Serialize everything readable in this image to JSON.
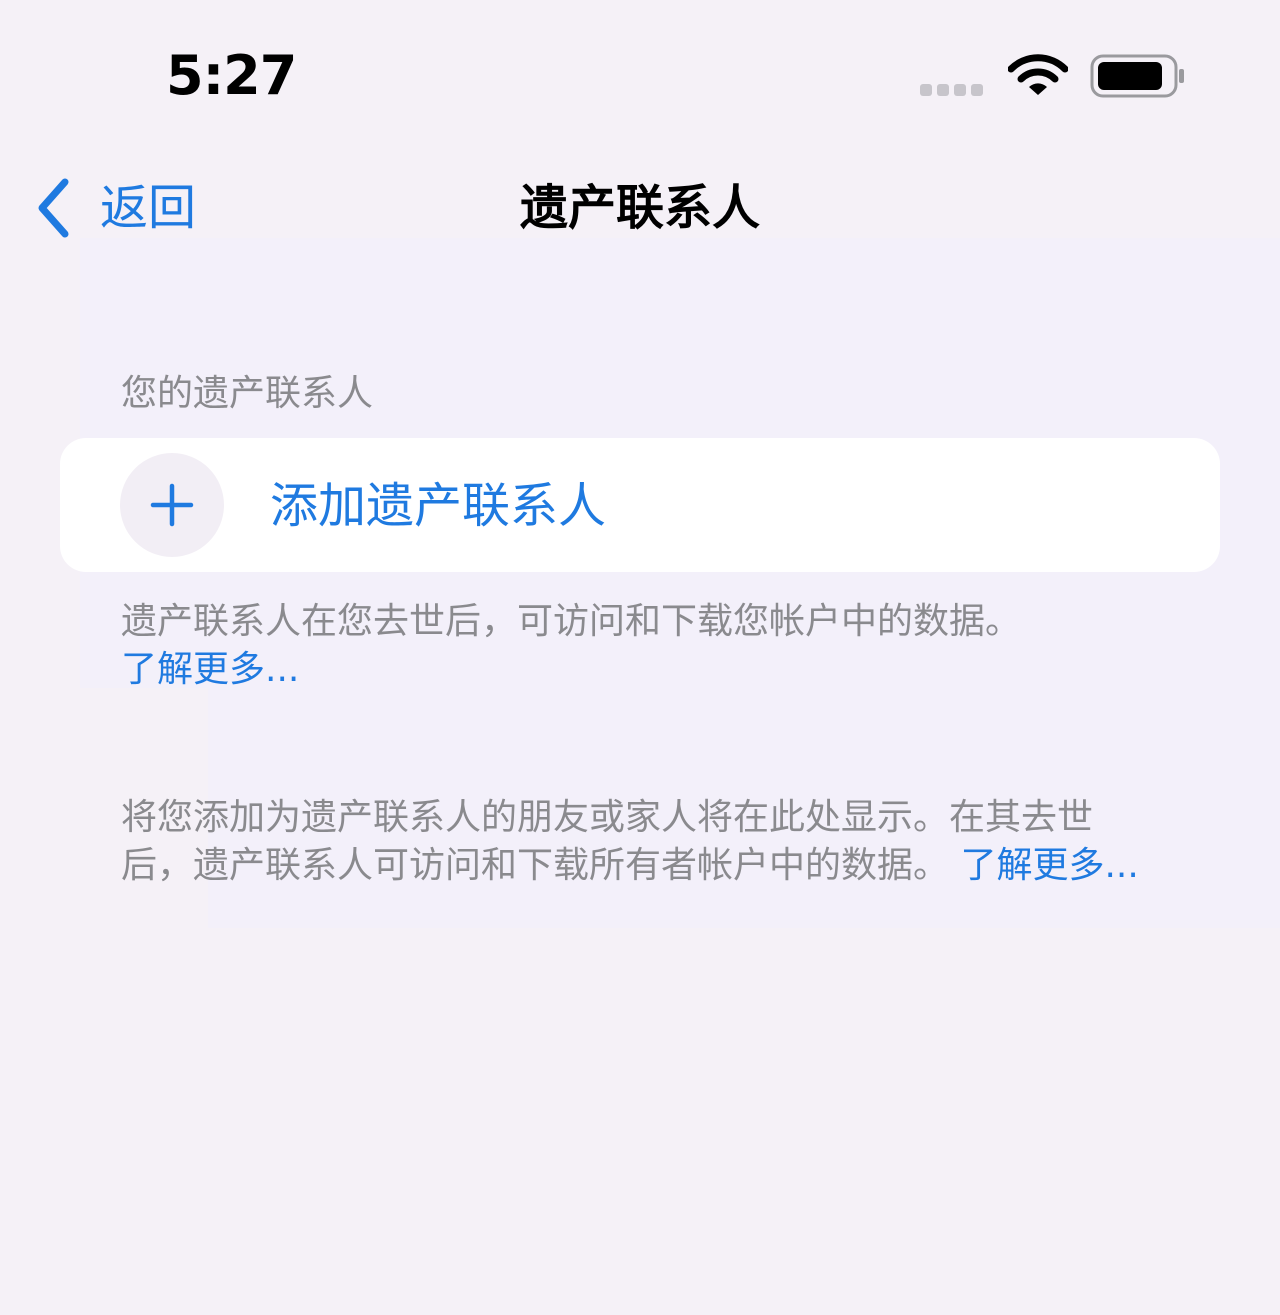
{
  "status_bar": {
    "time": "5:27"
  },
  "nav": {
    "back_label": "返回",
    "title": "遗产联系人"
  },
  "section": {
    "header": "您的遗产联系人",
    "add_label": "添加遗产联系人",
    "footer_text": "遗产联系人在您去世后，可访问和下载您帐户中的数据。",
    "footer_link": "了解更多..."
  },
  "info": {
    "text": "将您添加为遗产联系人的朋友或家人将在此处显示。在其去世后，遗产联系人可访问和下载所有者帐户中的数据。",
    "link": "了解更多..."
  },
  "colors": {
    "accent": "#1f7ae0",
    "background": "#f5f1f7",
    "secondary_text": "#8a8a8e"
  },
  "icons": [
    "wifi-icon",
    "battery-icon",
    "chevron-left-icon",
    "plus-icon"
  ]
}
